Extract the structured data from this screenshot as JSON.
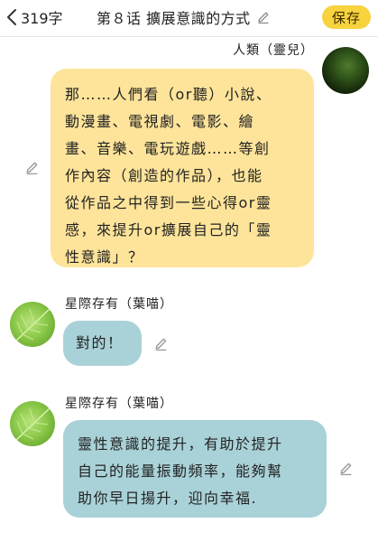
{
  "header": {
    "char_count": "319字",
    "title": "第８话 擴展意識的方式",
    "save_label": "保存"
  },
  "messages": [
    {
      "speaker": "人類（靈兒）",
      "lines": [
        "那……人們看（or聽）小說、",
        "動漫畫、電視劇、電影、繪",
        "畫、音樂、電玩遊戲……等創",
        "作內容（創造的作品），也能",
        "從作品之中得到一些心得or靈",
        "感，來提升or擴展自己的「靈",
        "性意識」？"
      ]
    },
    {
      "speaker": "星際存有（葉喵）",
      "lines": [
        "對的！"
      ]
    },
    {
      "speaker": "星際存有（葉喵）",
      "lines": [
        "靈性意識的提升，有助於提升",
        "自己的能量振動頻率，能夠幫",
        "助你早日揚升，迎向幸福."
      ]
    }
  ],
  "icons": {
    "back": "chevron-left-icon",
    "edit": "pencil-icon"
  },
  "colors": {
    "save_button": "#f7d33e",
    "human_bubble": "#fde49a",
    "being_bubble": "#a9d2d8"
  }
}
